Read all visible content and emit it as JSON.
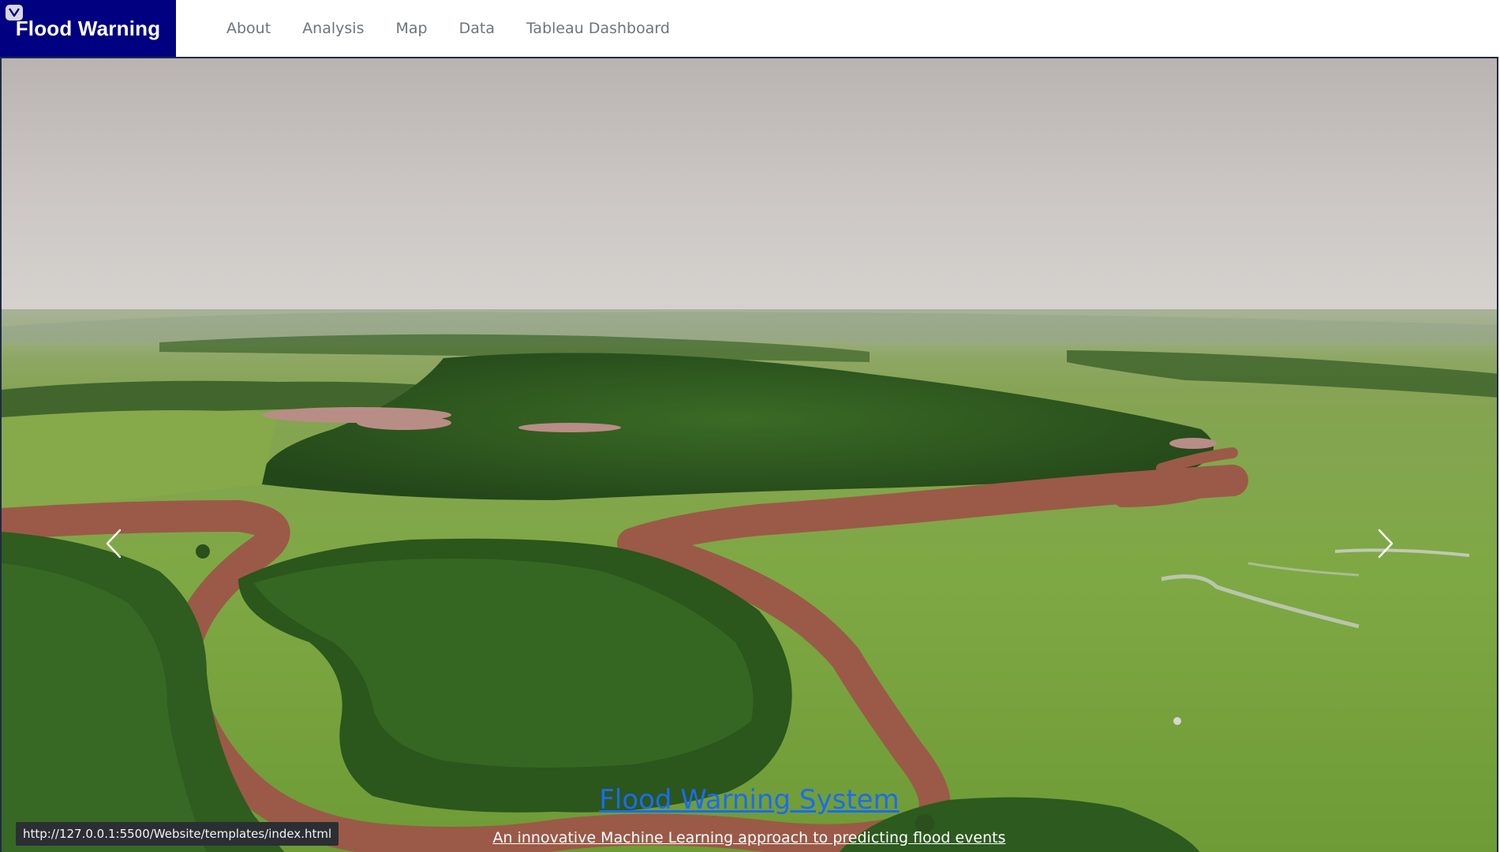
{
  "navbar": {
    "brand": "Flood Warning",
    "brand_color": "#000080",
    "links": [
      "About",
      "Analysis",
      "Map",
      "Data",
      "Tableau Dashboard"
    ]
  },
  "hero": {
    "title": "Flood Warning System",
    "subtitle": "An innovative Machine Learning approach to predicting flood events",
    "prev_icon": "chevron-left-icon",
    "next_icon": "chevron-right-icon",
    "image": "aerial view of a meandering brown river through green forest and grassland"
  },
  "status_bar": {
    "url": "http://127.0.0.1:5500/Website/templates/index.html"
  },
  "colors": {
    "link": "#1a6cf0",
    "nav_text": "#6c757d",
    "river": "#9a5a47",
    "grass": "#7da844",
    "forest": "#2d5a1f",
    "sky": "#c9c4c1"
  }
}
